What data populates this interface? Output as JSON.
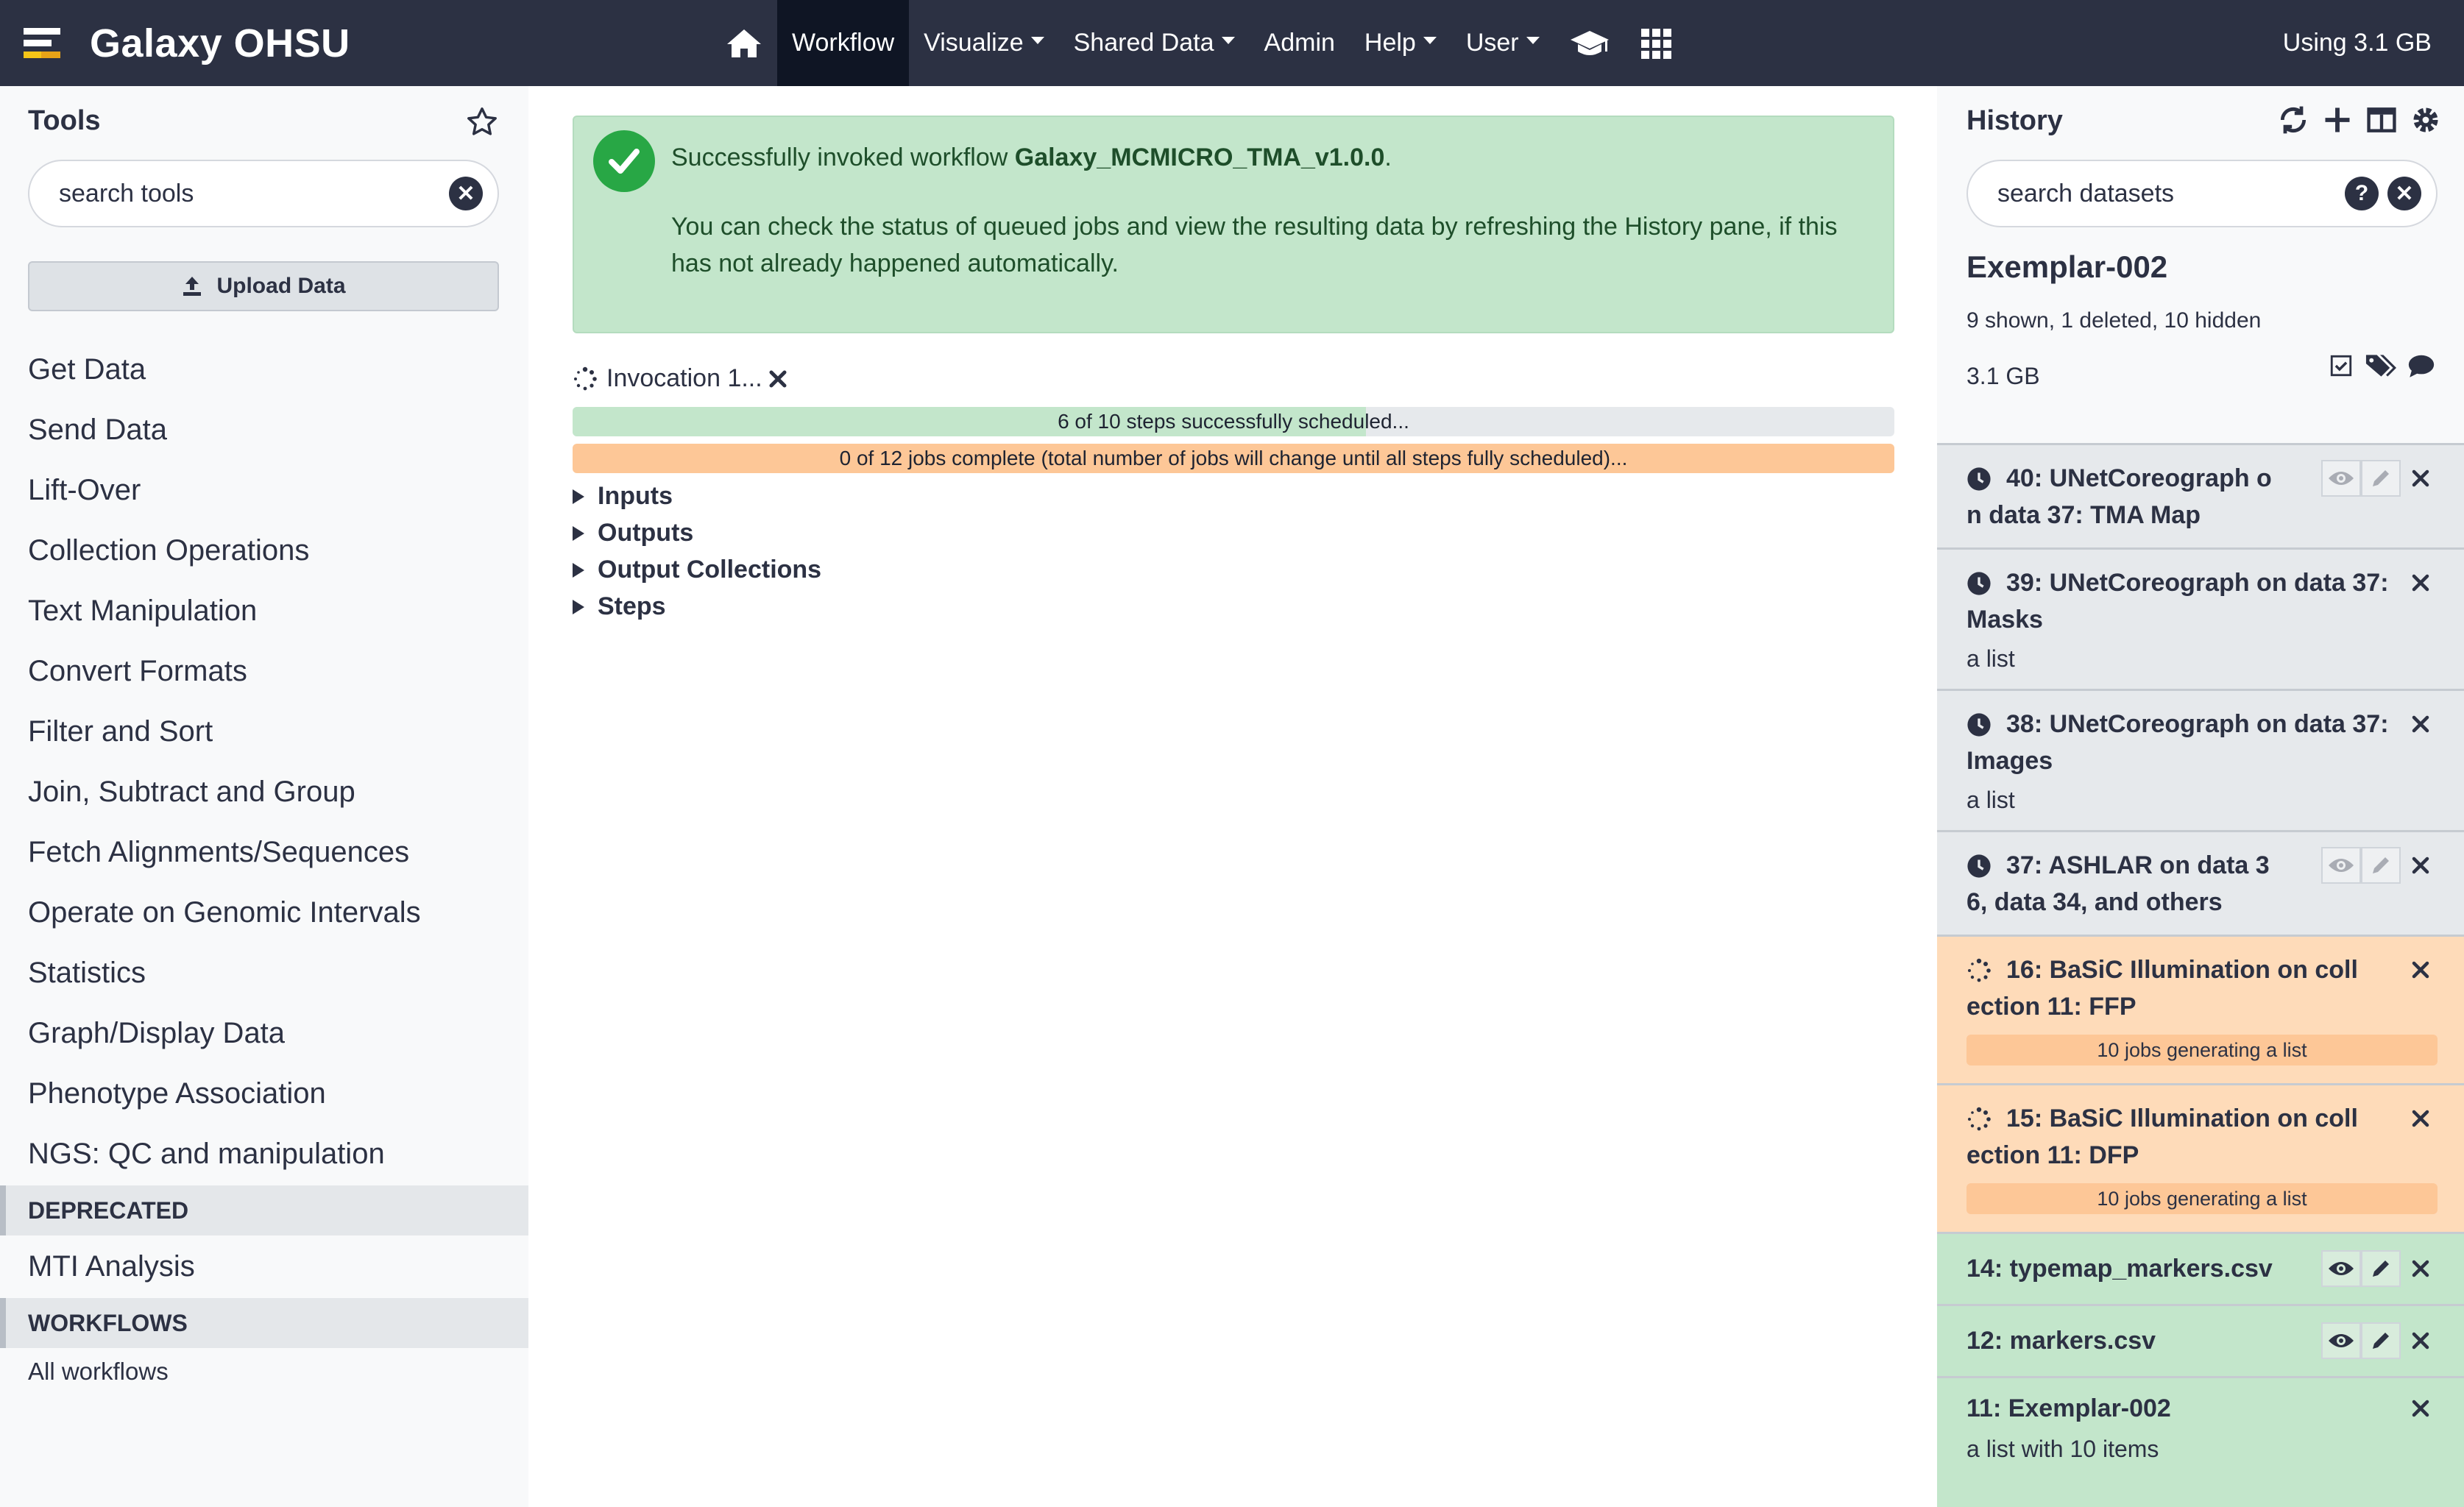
{
  "masthead": {
    "brand": "Galaxy OHSU",
    "nav": [
      {
        "label": "Workflow",
        "dropdown": false,
        "active": true
      },
      {
        "label": "Visualize",
        "dropdown": true
      },
      {
        "label": "Shared Data",
        "dropdown": true
      },
      {
        "label": "Admin",
        "dropdown": false
      },
      {
        "label": "Help",
        "dropdown": true
      },
      {
        "label": "User",
        "dropdown": true
      }
    ],
    "icons": [
      "home-icon",
      "graduation-cap-icon",
      "grid-icon"
    ],
    "usage": "Using 3.1 GB"
  },
  "tools": {
    "title": "Tools",
    "search_placeholder": "search tools",
    "upload_label": "Upload Data",
    "sections": [
      "Get Data",
      "Send Data",
      "Lift-Over",
      "Collection Operations",
      "Text Manipulation",
      "Convert Formats",
      "Filter and Sort",
      "Join, Subtract and Group",
      "Fetch Alignments/Sequences",
      "Operate on Genomic Intervals",
      "Statistics",
      "Graph/Display Data",
      "Phenotype Association",
      "NGS: QC and manipulation"
    ],
    "label_deprecated": "DEPRECATED",
    "section_mti": "MTI Analysis",
    "label_workflows": "WORKFLOWS",
    "all_workflows": "All workflows"
  },
  "center": {
    "alert_prefix": "Successfully invoked workflow ",
    "alert_workflow": "Galaxy_MCMICRO_TMA_v1.0.0",
    "alert_suffix": ".",
    "alert_body": "You can check the status of queued jobs and view the resulting data by refreshing the History pane, if this has not already happened automatically.",
    "invocation_label": "Invocation 1...",
    "steps_text": "6 of 10 steps successfully scheduled...",
    "steps_fraction": 0.6,
    "jobs_text": "0 of 12 jobs complete (total number of jobs will change until all steps fully scheduled)...",
    "sections": [
      "Inputs",
      "Outputs",
      "Output Collections",
      "Steps"
    ]
  },
  "history": {
    "title": "History",
    "search_placeholder": "search datasets",
    "name": "Exemplar-002",
    "counts": "9 shown, 1 deleted, 10 hidden",
    "size": "3.1 GB",
    "datasets": [
      {
        "title": "40: UNetCoreograph o n data 37: TMA Map",
        "state": "queued"
      },
      {
        "title": "39: UNetCoreograph on data 37: Masks",
        "sub": "a list",
        "state": "queued"
      },
      {
        "title": "38: UNetCoreograph on data 37: Images",
        "sub": "a list",
        "state": "queued"
      },
      {
        "title": "37: ASHLAR on data 3 6, data 34, and others",
        "state": "queued"
      },
      {
        "title": "16: BaSiC Illumination on coll ection 11: FFP",
        "progress": "10 jobs generating a list",
        "state": "running"
      },
      {
        "title": "15: BaSiC Illumination on coll ection 11: DFP",
        "progress": "10 jobs generating a list",
        "state": "running"
      },
      {
        "title": "14: typemap_markers.csv",
        "state": "ok"
      },
      {
        "title": "12: markers.csv",
        "state": "ok"
      },
      {
        "title": "11: Exemplar-002",
        "sub": "a list with 10 items",
        "state": "ok"
      }
    ]
  }
}
